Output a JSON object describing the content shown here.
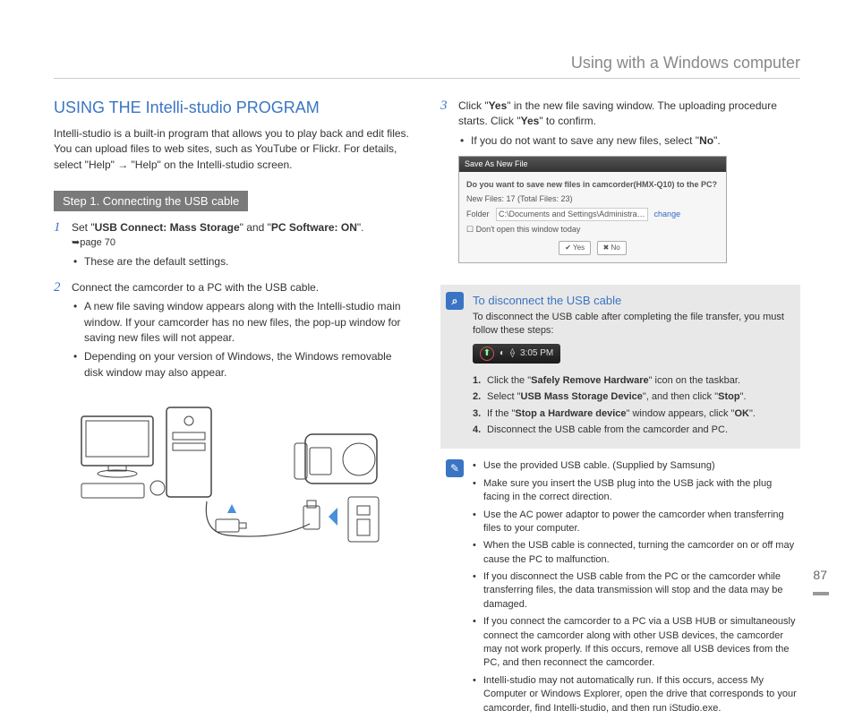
{
  "header": {
    "title": "Using with a Windows computer"
  },
  "pageNumber": "87",
  "left": {
    "sectionTitle": "USING THE Intelli-studio PROGRAM",
    "intro": "Intelli-studio is a built-in program that allows you to play back and edit files. You can upload files to web sites, such as YouTube or Flickr. For details, select \"Help\" → \"Help\" on the Intelli-studio screen.",
    "stepBar": "Step 1. Connecting the USB cable",
    "step1": {
      "num": "1",
      "prefix": "Set \"",
      "b1": "USB Connect: Mass Storage",
      "mid": "\" and \"",
      "b2": "PC Software: ON",
      "suffix": "\".",
      "ref": "➥page 70",
      "bullet1": "These are the default settings."
    },
    "step2": {
      "num": "2",
      "text": "Connect the camcorder to a PC with the USB cable.",
      "bullet1": "A new file saving window appears along with the Intelli-studio main window. If your camcorder has no new files, the pop-up window for saving new files will not appear.",
      "bullet2": "Depending on your version of Windows, the Windows removable disk window may also appear."
    }
  },
  "right": {
    "step3": {
      "num": "3",
      "p1a": "Click \"",
      "p1b": "Yes",
      "p1c": "\" in the new file saving window. The uploading procedure starts. Click \"",
      "p1d": "Yes",
      "p1e": "\" to confirm.",
      "bullet_a": "If you do not want to save any new files, select \"",
      "bullet_b": "No",
      "bullet_c": "\"."
    },
    "dialog": {
      "title": "Save As New File",
      "q": "Do you want to save new files in camcorder(HMX-Q10) to the PC?",
      "line1": "New Files: 17 (Total Files: 23)",
      "folderLabel": "Folder",
      "folderPath": "C:\\Documents and Settings\\Administrator\\My Documents\\Intelli-st…",
      "change": "change",
      "checkbox": "Don't open this window today",
      "yes": "Yes",
      "no": "No"
    },
    "infoBox": {
      "title": "To disconnect the USB cable",
      "intro": "To disconnect the USB cable after completing the file transfer, you must follow these steps:",
      "time": "3:05 PM",
      "s1": {
        "n": "1.",
        "a": "Click the \"",
        "b": "Safely Remove Hardware",
        "c": "\" icon on the taskbar."
      },
      "s2": {
        "n": "2.",
        "a": "Select \"",
        "b": "USB Mass Storage Device",
        "c": "\", and then click \"",
        "d": "Stop",
        "e": "\"."
      },
      "s3": {
        "n": "3.",
        "a": "If the \"",
        "b": "Stop a Hardware device",
        "c": "\" window appears, click \"",
        "d": "OK",
        "e": "\"."
      },
      "s4": {
        "n": "4.",
        "a": "Disconnect the USB cable from the camcorder and PC."
      }
    },
    "notes": {
      "b1": "Use the provided USB cable. (Supplied by Samsung)",
      "b2": "Make sure you insert the USB plug into the USB jack with the plug facing in the correct direction.",
      "b3": "Use the AC power adaptor to power the camcorder when transferring files to your computer.",
      "b4": "When the USB cable is connected, turning the camcorder on or off may cause the PC to malfunction.",
      "b5": "If you disconnect the USB cable from the PC or the camcorder while transferring files, the data transmission will stop and the data may be damaged.",
      "b6": "If you connect the camcorder to a PC via a USB HUB or simultaneously connect the camcorder along with other USB devices, the camcorder may not work properly. If this occurs, remove all USB devices from the PC, and then reconnect the camcorder.",
      "b7": "Intelli-studio may not automatically run. If this occurs, access My Computer or Windows Explorer, open the drive that corresponds to your camcorder, find Intelli-studio, and then run iStudio.exe."
    }
  }
}
